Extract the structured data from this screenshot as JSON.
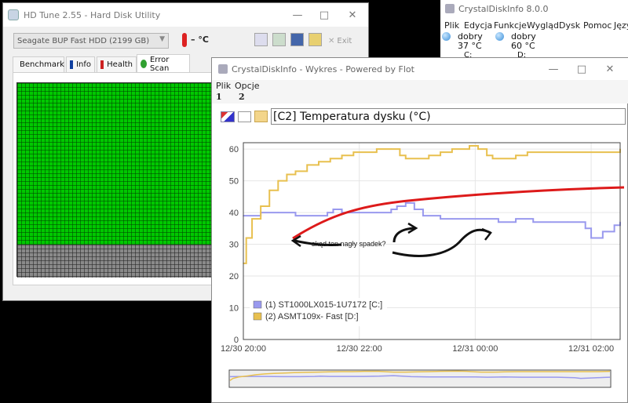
{
  "hdtune": {
    "title": "HD Tune 2.55 - Hard Disk Utility",
    "drive_select": "Seagate BUP Fast HDD (2199 GB)",
    "temperature": "– °C",
    "exit_label": "Exit",
    "tabs": [
      {
        "label": "Benchmark",
        "icon": "lightbulb-icon"
      },
      {
        "label": "Info",
        "icon": "info-icon"
      },
      {
        "label": "Health",
        "icon": "health-cross-icon"
      },
      {
        "label": "Error Scan",
        "icon": "magnifier-icon"
      }
    ],
    "scan_colors": {
      "ok": "#00c800",
      "pending": "#808080",
      "grid": "#1b5e1b"
    }
  },
  "crystal_main": {
    "title": "CrystalDiskInfo 8.0.0",
    "menu": [
      "Plik",
      "Edycja",
      "Funkcje",
      "Wygląd",
      "Dysk",
      "Pomoc",
      "Języ"
    ],
    "disks": [
      {
        "status": "dobry",
        "temp": "37 °C",
        "letter": "C:"
      },
      {
        "status": "dobry",
        "temp": "60 °C",
        "letter": "D:"
      }
    ]
  },
  "graph_window": {
    "title": "CrystalDiskInfo - Wykres - Powered by Flot",
    "menu": [
      {
        "label": "Plik",
        "hotkey": "1"
      },
      {
        "label": "Opcje",
        "hotkey": "2"
      }
    ],
    "attribute_select": "[C2] Temperatura dysku (°C)",
    "annotation": "skąd ten nagły spadek?"
  },
  "chart_data": {
    "type": "line",
    "title": "",
    "xlabel": "",
    "ylabel": "",
    "ylim": [
      0,
      62
    ],
    "yticks": [
      0,
      10,
      20,
      30,
      40,
      50,
      60
    ],
    "xticks": [
      "12/30 20:00",
      "12/30 22:00",
      "12/31 00:00",
      "12/31 02:00"
    ],
    "xlim_hours": [
      0,
      6.5
    ],
    "grid": true,
    "legend_position": "bottom-left",
    "series": [
      {
        "name": "(1) ST1000LX015-1U7172 [C:]",
        "color": "#9999ee",
        "points": [
          [
            0,
            39
          ],
          [
            0.3,
            40
          ],
          [
            0.6,
            40
          ],
          [
            0.9,
            39
          ],
          [
            1.2,
            39
          ],
          [
            1.45,
            40
          ],
          [
            1.55,
            41
          ],
          [
            1.7,
            40
          ],
          [
            2.0,
            40
          ],
          [
            2.3,
            40
          ],
          [
            2.55,
            41
          ],
          [
            2.65,
            42
          ],
          [
            2.8,
            43
          ],
          [
            2.95,
            41
          ],
          [
            3.1,
            39
          ],
          [
            3.4,
            38
          ],
          [
            3.6,
            38
          ],
          [
            3.9,
            38
          ],
          [
            4.2,
            38
          ],
          [
            4.4,
            37
          ],
          [
            4.7,
            38
          ],
          [
            5.0,
            37
          ],
          [
            5.3,
            37
          ],
          [
            5.6,
            37
          ],
          [
            5.9,
            35
          ],
          [
            6.0,
            32
          ],
          [
            6.2,
            34
          ],
          [
            6.4,
            36
          ],
          [
            6.5,
            37
          ]
        ]
      },
      {
        "name": "(2) ASMT109x- Fast [D:]",
        "color": "#e8c04f",
        "points": [
          [
            0,
            24
          ],
          [
            0.05,
            32
          ],
          [
            0.15,
            38
          ],
          [
            0.3,
            42
          ],
          [
            0.45,
            47
          ],
          [
            0.6,
            50
          ],
          [
            0.75,
            52
          ],
          [
            0.9,
            53
          ],
          [
            1.1,
            55
          ],
          [
            1.3,
            56
          ],
          [
            1.5,
            57
          ],
          [
            1.7,
            58
          ],
          [
            1.9,
            59
          ],
          [
            2.1,
            59
          ],
          [
            2.3,
            60
          ],
          [
            2.55,
            60
          ],
          [
            2.7,
            58
          ],
          [
            2.8,
            57
          ],
          [
            3.0,
            57
          ],
          [
            3.2,
            58
          ],
          [
            3.4,
            59
          ],
          [
            3.6,
            60
          ],
          [
            3.9,
            61
          ],
          [
            4.05,
            60
          ],
          [
            4.2,
            58
          ],
          [
            4.3,
            57
          ],
          [
            4.5,
            57
          ],
          [
            4.7,
            58
          ],
          [
            4.9,
            59
          ],
          [
            5.1,
            59
          ],
          [
            5.3,
            59
          ],
          [
            5.6,
            59
          ],
          [
            5.9,
            59
          ],
          [
            6.1,
            59
          ],
          [
            6.3,
            59
          ],
          [
            6.5,
            60
          ]
        ]
      }
    ]
  }
}
